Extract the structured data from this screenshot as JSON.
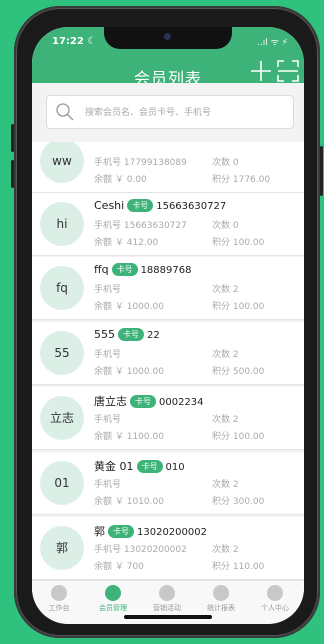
{
  "status_bar": {
    "time": "17:22 ☾",
    "icons": "..ıl ᯤ ⚡"
  },
  "app_bar": {
    "title": "会员列表"
  },
  "search": {
    "placeholder": "搜索会员名、会员卡号、手机号"
  },
  "members": [
    {
      "avatar": "ww",
      "name": "",
      "badge": "",
      "card": "",
      "phone_label": "手机号 17799138089",
      "balance_label": "余额 ￥ 0.00",
      "visits_label": "次数 0",
      "points_label": "积分 1776.00"
    },
    {
      "avatar": "hi",
      "name": "Ceshi",
      "badge": "卡号",
      "card": "15663630727",
      "phone_label": "手机号 15663630727",
      "balance_label": "余额 ￥ 412.00",
      "visits_label": "次数 0",
      "points_label": "积分 100.00"
    },
    {
      "avatar": "fq",
      "name": "ffq",
      "badge": "卡号",
      "card": "18889768",
      "phone_label": "手机号",
      "balance_label": "余额 ￥ 1000.00",
      "visits_label": "次数 2",
      "points_label": "积分 100.00"
    },
    {
      "avatar": "55",
      "name": "555",
      "badge": "卡号",
      "card": "22",
      "phone_label": "手机号",
      "balance_label": "余额 ￥ 1000.00",
      "visits_label": "次数 2",
      "points_label": "积分 500.00"
    },
    {
      "avatar": "立志",
      "name": "唐立志",
      "badge": "卡号",
      "card": "0002234",
      "phone_label": "手机号",
      "balance_label": "余额 ￥ 1100.00",
      "visits_label": "次数 2",
      "points_label": "积分 100.00"
    },
    {
      "avatar": "01",
      "name": "黄金 01",
      "badge": "卡号",
      "card": "010",
      "phone_label": "手机号",
      "balance_label": "余额 ￥ 1010.00",
      "visits_label": "次数 2",
      "points_label": "积分 300.00"
    },
    {
      "avatar": "郭",
      "name": "郭",
      "badge": "卡号",
      "card": "13020200002",
      "phone_label": "手机号 13020200002",
      "balance_label": "余额 ￥ 700",
      "visits_label": "次数 2",
      "points_label": "积分 110.00"
    }
  ],
  "tabs": [
    {
      "label": "工作台",
      "icon": "home-icon"
    },
    {
      "label": "会员管理",
      "icon": "member-icon"
    },
    {
      "label": "营销活动",
      "icon": "bulb-icon"
    },
    {
      "label": "统计报表",
      "icon": "plus-circle-icon"
    },
    {
      "label": "个人中心",
      "icon": "person-icon"
    }
  ],
  "colors": {
    "brand_green": "#3db37a",
    "background_green": "#2ec27e"
  }
}
